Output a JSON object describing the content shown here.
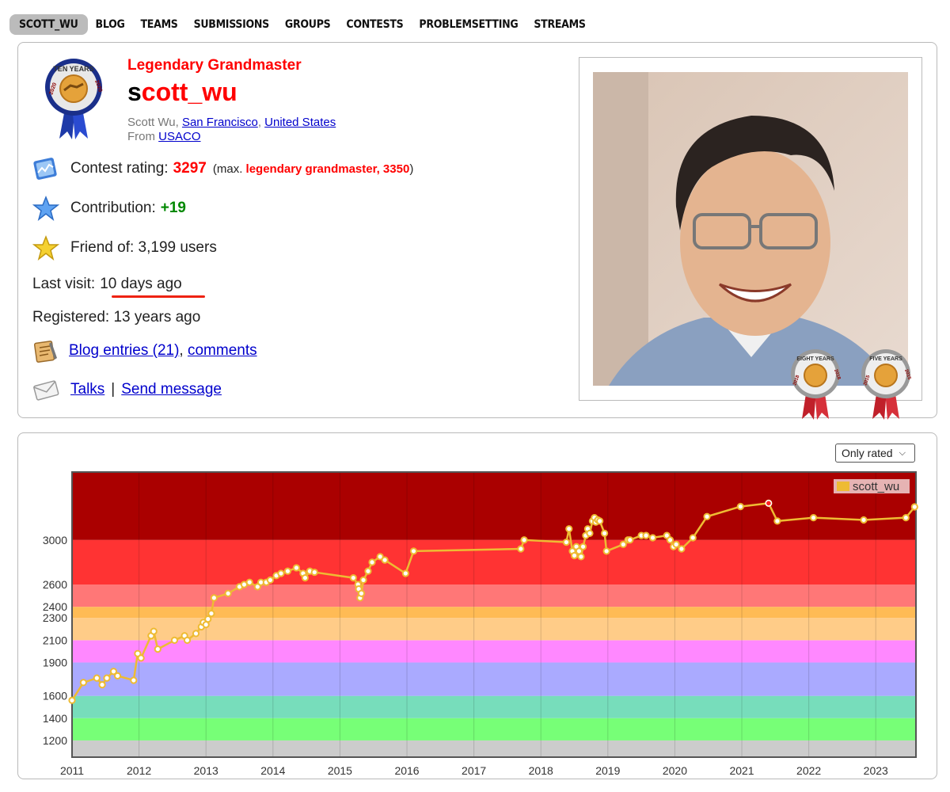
{
  "nav": {
    "items": [
      "SCOTT_WU",
      "BLOG",
      "TEAMS",
      "SUBMISSIONS",
      "GROUPS",
      "CONTESTS",
      "PROBLEMSETTING",
      "STREAMS"
    ]
  },
  "profile": {
    "rank": "Legendary Grandmaster",
    "handle_first": "s",
    "handle_rest": "cott_wu",
    "name": "Scott Wu",
    "name_sep": ", ",
    "city": "San Francisco",
    "country": "United States",
    "from_label": "From ",
    "org": "USACO",
    "badges": {
      "ten_years": {
        "text": "TEN YEARS",
        "year": "2020"
      },
      "eight_years": {
        "text": "EIGHT YEARS",
        "year": "2018"
      },
      "five_years": {
        "text": "FIVE YEARS",
        "year": "2015"
      }
    }
  },
  "stats": {
    "rating_label": "Contest rating:",
    "rating_value": "3297",
    "max_open": "(max.",
    "max_text": "legendary grandmaster, 3350",
    "max_close": ")",
    "contribution_label": "Contribution:",
    "contribution_value": "+19",
    "friends_label": "Friend of: 3,199 users",
    "last_visit_label": "Last visit:",
    "last_visit_value": "10 days ago",
    "registered": "Registered: 13 years ago",
    "blog_link": "Blog entries (21)",
    "comma": ",",
    "comments_link": "comments",
    "talks_link": "Talks",
    "pipe": "|",
    "send_link": "Send message"
  },
  "icons": {
    "rating": "rating-chart-icon",
    "contribution": "blue-star-icon",
    "friends": "gold-star-icon",
    "blog": "blog-notepad-icon",
    "talks": "envelope-icon"
  },
  "filter": {
    "selected": "Only rated"
  },
  "chart_data": {
    "type": "line",
    "title": "",
    "xlabel": "",
    "ylabel": "",
    "xlim": [
      2011,
      2023.6
    ],
    "ylim": [
      1050,
      3610
    ],
    "x_ticks": [
      "2011",
      "2012",
      "2013",
      "2014",
      "2015",
      "2016",
      "2017",
      "2018",
      "2019",
      "2020",
      "2021",
      "2022",
      "2023"
    ],
    "y_ticks": [
      1200,
      1400,
      1600,
      1900,
      2100,
      2300,
      2400,
      2600,
      3000
    ],
    "legend": {
      "position": "top-right"
    },
    "grid": true,
    "bands": [
      {
        "from": 1050,
        "to": 1200,
        "color": "#cccccc"
      },
      {
        "from": 1200,
        "to": 1400,
        "color": "#77ff77"
      },
      {
        "from": 1400,
        "to": 1600,
        "color": "#77ddbb"
      },
      {
        "from": 1600,
        "to": 1900,
        "color": "#aaaaff"
      },
      {
        "from": 1900,
        "to": 2100,
        "color": "#ff88ff"
      },
      {
        "from": 2100,
        "to": 2300,
        "color": "#ffcc88"
      },
      {
        "from": 2300,
        "to": 2400,
        "color": "#ffbb55"
      },
      {
        "from": 2400,
        "to": 2600,
        "color": "#ff7777"
      },
      {
        "from": 2600,
        "to": 3000,
        "color": "#ff3333"
      },
      {
        "from": 3000,
        "to": 3610,
        "color": "#aa0000"
      }
    ],
    "series": [
      {
        "name": "scott_wu",
        "color": "#eebb33",
        "x": [
          2011.0,
          2011.17,
          2011.37,
          2011.45,
          2011.52,
          2011.62,
          2011.68,
          2011.92,
          2011.98,
          2012.03,
          2012.18,
          2012.22,
          2012.28,
          2012.53,
          2012.68,
          2012.72,
          2012.85,
          2012.93,
          2012.96,
          2013.0,
          2013.03,
          2013.08,
          2013.12,
          2013.33,
          2013.5,
          2013.57,
          2013.65,
          2013.77,
          2013.82,
          2013.9,
          2013.96,
          2014.05,
          2014.12,
          2014.22,
          2014.35,
          2014.45,
          2014.48,
          2014.55,
          2014.62,
          2015.2,
          2015.27,
          2015.28,
          2015.3,
          2015.32,
          2015.35,
          2015.42,
          2015.48,
          2015.6,
          2015.67,
          2015.98,
          2016.1,
          2017.7,
          2017.75,
          2018.38,
          2018.42,
          2018.47,
          2018.5,
          2018.53,
          2018.57,
          2018.6,
          2018.63,
          2018.67,
          2018.7,
          2018.73,
          2018.77,
          2018.8,
          2018.82,
          2018.85,
          2018.88,
          2018.95,
          2018.98,
          2019.23,
          2019.3,
          2019.33,
          2019.5,
          2019.57,
          2019.67,
          2019.88,
          2019.93,
          2019.98,
          2020.02,
          2020.1,
          2020.27,
          2020.48,
          2020.98,
          2021.4,
          2021.53,
          2022.07,
          2022.82,
          2023.45,
          2023.58
        ],
        "values": [
          1560,
          1720,
          1760,
          1700,
          1760,
          1820,
          1780,
          1740,
          1980,
          1940,
          2140,
          2180,
          2020,
          2100,
          2140,
          2100,
          2160,
          2220,
          2260,
          2240,
          2290,
          2340,
          2480,
          2520,
          2580,
          2600,
          2620,
          2580,
          2620,
          2620,
          2640,
          2680,
          2700,
          2720,
          2750,
          2700,
          2660,
          2720,
          2710,
          2660,
          2600,
          2560,
          2480,
          2520,
          2640,
          2720,
          2800,
          2850,
          2820,
          2700,
          2900,
          2920,
          3000,
          2980,
          3100,
          2900,
          2860,
          2940,
          2900,
          2850,
          2940,
          3040,
          3100,
          3060,
          3170,
          3200,
          3160,
          3180,
          3170,
          3060,
          2900,
          2960,
          3000,
          3000,
          3040,
          3040,
          3020,
          3040,
          3000,
          2940,
          2960,
          2920,
          3020,
          3210,
          3300,
          3330,
          3170,
          3200,
          3180,
          3200,
          3297
        ]
      }
    ],
    "markers": [
      {
        "x": 2021.4,
        "value": 3330,
        "color": "#ff2222"
      }
    ]
  }
}
